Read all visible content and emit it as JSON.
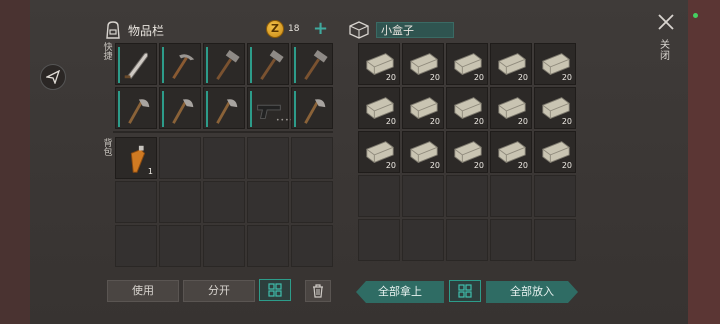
{
  "inventory": {
    "title": "物品栏",
    "coins": "18",
    "coin_symbol": "Z",
    "quick_label": "快捷",
    "backpack_label": "背包",
    "quick_slots": [
      {
        "item": "machete-icon",
        "qty": ""
      },
      {
        "item": "pickaxe-icon",
        "qty": ""
      },
      {
        "item": "hammer-icon",
        "qty": ""
      },
      {
        "item": "hammer-icon",
        "qty": ""
      },
      {
        "item": "hammer-icon",
        "qty": ""
      },
      {
        "item": "hatchet-icon",
        "qty": ""
      },
      {
        "item": "hatchet-icon",
        "qty": ""
      },
      {
        "item": "hatchet-icon",
        "qty": ""
      },
      {
        "item": "pistol-icon",
        "qty": ""
      },
      {
        "item": "hatchet-icon",
        "qty": ""
      }
    ],
    "backpack_slots": [
      {
        "item": "carrot-bottle-icon",
        "qty": "1"
      }
    ],
    "buttons": {
      "use": "使用",
      "split": "分开"
    }
  },
  "container": {
    "name": "小盒子",
    "close_label": "关闭",
    "item_icon": "brick-icon",
    "filled_slots": 15,
    "slot_qty": "20",
    "buttons": {
      "take_all": "全部拿上",
      "put_all": "全部放入"
    }
  },
  "colors": {
    "accent": "#2d9c8a",
    "teal_button": "#2f6c64",
    "status_dot": "#44d060"
  }
}
